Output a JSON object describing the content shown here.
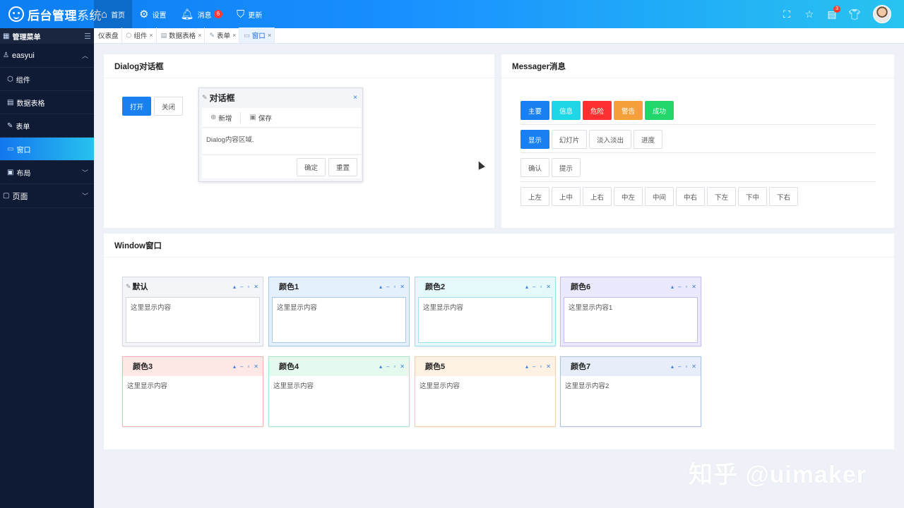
{
  "app": {
    "title": "后台管理",
    "title_sub": "系统"
  },
  "topnav": [
    {
      "label": "首页",
      "icon": "home-icon"
    },
    {
      "label": "设置",
      "icon": "gear-icon"
    },
    {
      "label": "消息",
      "icon": "bell-icon",
      "badge": "6"
    },
    {
      "label": "更新",
      "icon": "shield-icon"
    }
  ],
  "header_tools": {
    "notify_badge": "3"
  },
  "sidebar": {
    "header": "管理菜单",
    "group": "easyui",
    "items": [
      {
        "label": "组件"
      },
      {
        "label": "数据表格"
      },
      {
        "label": "表单"
      },
      {
        "label": "窗口"
      },
      {
        "label": "布局"
      }
    ],
    "group2": "页面"
  },
  "tabs": [
    {
      "label": "仪表盘"
    },
    {
      "label": "组件"
    },
    {
      "label": "数据表格"
    },
    {
      "label": "表单"
    },
    {
      "label": "窗口"
    }
  ],
  "tab_close": "×",
  "dialog_panel": {
    "title": "Dialog对话框",
    "open_label": "打开",
    "close_label": "关闭",
    "dialog": {
      "title": "对话框",
      "close": "×",
      "tool_add": "新增",
      "tool_save": "保存",
      "content": "Dialog内容区域.",
      "ok": "确定",
      "reset": "重置"
    }
  },
  "messager_panel": {
    "title": "Messager消息",
    "row1": [
      "主要",
      "信息",
      "危险",
      "警告",
      "成功"
    ],
    "row2": [
      "显示",
      "幻灯片",
      "淡入淡出",
      "进度"
    ],
    "row3": [
      "确认",
      "提示"
    ],
    "row4": [
      "上左",
      "上中",
      "上右",
      "中左",
      "中间",
      "中右",
      "下左",
      "下中",
      "下右"
    ]
  },
  "window_panel": {
    "title": "Window窗口",
    "windows": [
      {
        "title": "默认",
        "content": "这里显示内容",
        "color": "#d5d9e0",
        "head": "#f3f5f8"
      },
      {
        "title": "颜色1",
        "content": "这里显示内容",
        "color": "#a9c8f0",
        "head": "#e5f0fd"
      },
      {
        "title": "颜色2",
        "content": "这里显示内容",
        "color": "#9fe0ea",
        "head": "#e5f9fb"
      },
      {
        "title": "颜色6",
        "content": "这里显示内容1",
        "color": "#c3c0f0",
        "head": "#ebe9fd"
      },
      {
        "title": "颜色3",
        "content": "这里显示内容",
        "color": "#f5b5ad",
        "head": "#fde8e5"
      },
      {
        "title": "颜色4",
        "content": "这里显示内容",
        "color": "#a9e6c7",
        "head": "#e6f9ef"
      },
      {
        "title": "颜色5",
        "content": "这里显示内容",
        "color": "#f5d0aa",
        "head": "#fdf1e4"
      },
      {
        "title": "颜色7",
        "content": "这里显示内容2",
        "color": "#a9c3e8",
        "head": "#e7eefa"
      }
    ]
  },
  "watermark": "知乎 @uimaker"
}
